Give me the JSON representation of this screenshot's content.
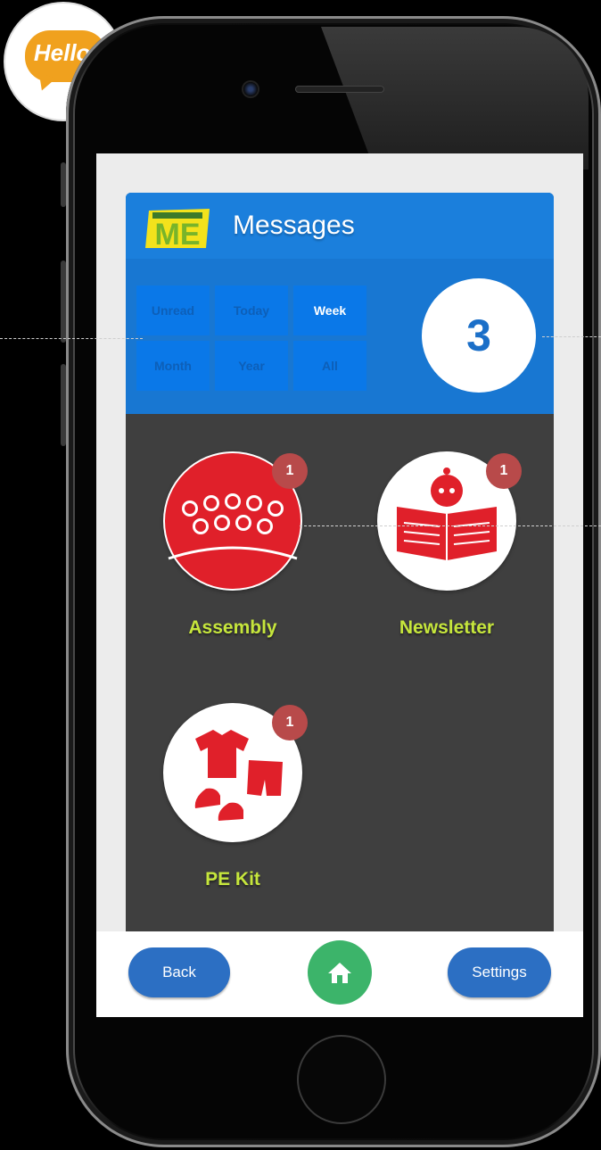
{
  "badge_logo": {
    "text": "Hello!"
  },
  "header": {
    "title": "Messages",
    "logo_text": "ME"
  },
  "filters": [
    {
      "label": "Unread",
      "active": false
    },
    {
      "label": "Today",
      "active": false
    },
    {
      "label": "Week",
      "active": true
    },
    {
      "label": "Month",
      "active": false
    },
    {
      "label": "Year",
      "active": false
    },
    {
      "label": "All",
      "active": false
    }
  ],
  "message_count": "3",
  "categories": [
    {
      "label": "Assembly",
      "badge": "1",
      "icon": "people-group-icon"
    },
    {
      "label": "Newsletter",
      "badge": "1",
      "icon": "newspaper-reader-icon"
    },
    {
      "label": "PE Kit",
      "badge": "1",
      "icon": "clothing-icon"
    }
  ],
  "toolbar": {
    "back_label": "Back",
    "settings_label": "Settings",
    "home_icon": "home-icon"
  },
  "colors": {
    "header_blue": "#1877d2",
    "content_dark": "#3f3f3f",
    "label_green": "#c6e63c",
    "icon_red": "#e0202a",
    "badge_red": "#b84a4a",
    "home_green": "#3cb46a",
    "button_blue": "#2c6fc3"
  }
}
